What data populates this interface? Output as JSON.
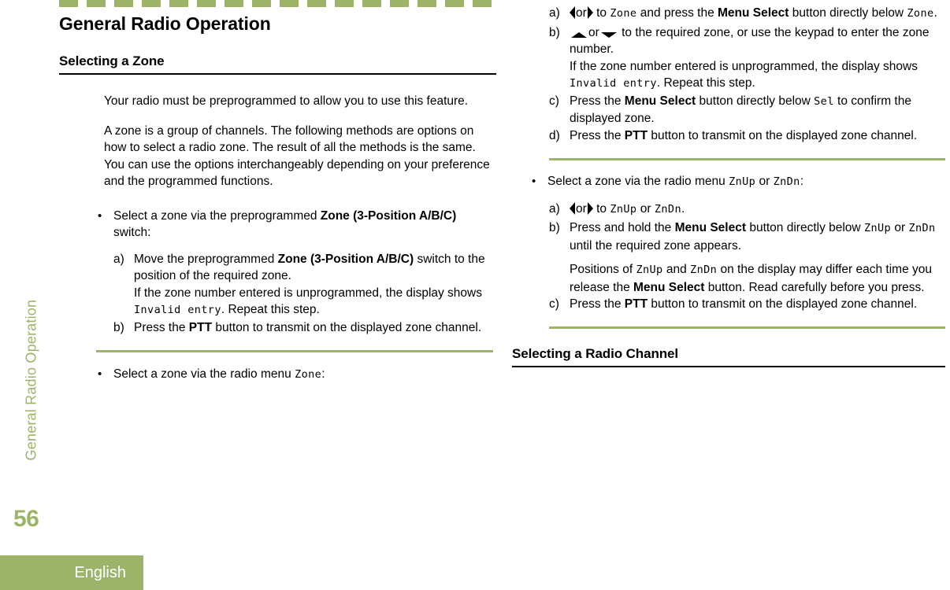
{
  "colors": {
    "accent_green": "#9cb46a",
    "text_black": "#000000",
    "white": "#ffffff"
  },
  "sidebar": {
    "chapter_tab": "General Radio Operation",
    "page_number": "56",
    "language": "English"
  },
  "left_column": {
    "chapter_title": "General Radio Operation",
    "section_heading": "Selecting a Zone",
    "paragraph_1": "Your radio must be preprogrammed to allow you to use this feature.",
    "paragraph_2": "A zone is a group of channels. The following methods are options on how to select a radio zone. The result of all the methods is the same. You can use the options interchangeably depending on your preference and the programmed functions.",
    "bullet_1": {
      "marker": "•",
      "text_part_1": "Select a zone via the preprogrammed ",
      "bold_part": "Zone (3-Position A/B/C)",
      "text_part_2": " switch:",
      "steps": [
        {
          "marker": "a)",
          "lines": [
            {
              "text_part_1": "Move the preprogrammed ",
              "bold_part": "Zone (3-Position A/B/C)",
              "text_part_2": " switch to the position of the required zone."
            },
            {
              "text_part_1": "If the zone number entered is unprogrammed, the display shows ",
              "lcd": "Invalid entry",
              "text_part_2": ". Repeat this step."
            }
          ]
        },
        {
          "marker": "b)",
          "lines": [
            {
              "text_part_1": "Press the ",
              "bold_part": "PTT",
              "text_part_2": " button to transmit on the displayed zone channel."
            }
          ]
        }
      ]
    },
    "bullet_2": {
      "marker": "•",
      "text_part_1": "Select a zone via the radio menu ",
      "lcd": "Zone",
      "text_part_2": ":"
    }
  },
  "right_column": {
    "steps_continued": [
      {
        "marker": "a)",
        "icon_left": "arrow-left-icon",
        "icon_right": "arrow-right-icon",
        "or_text": "or",
        "text_part_1": " to ",
        "lcd_1": "Zone",
        "text_part_2": " and press the ",
        "bold_part": "Menu Select",
        "text_part_3": " button directly below ",
        "lcd_2": "Zone",
        "text_part_4": "."
      },
      {
        "marker": "b)",
        "icon_up": "arrow-up-icon",
        "icon_down": "arrow-down-icon",
        "or_text": "or",
        "text_part_1": " to the required zone, or use the keypad to enter the zone number.",
        "sub_line": {
          "text_part_1": "If the zone number entered is unprogrammed, the display shows ",
          "lcd": "Invalid entry",
          "text_part_2": ". Repeat this step."
        }
      },
      {
        "marker": "c)",
        "text_part_1": "Press the ",
        "bold_part": "Menu Select",
        "text_part_2": " button directly below ",
        "lcd": "Sel",
        "text_part_3": " to confirm the displayed zone."
      },
      {
        "marker": "d)",
        "text_part_1": "Press the ",
        "bold_part": "PTT",
        "text_part_2": " button to transmit on the displayed zone channel."
      }
    ],
    "bullet_3": {
      "marker": "•",
      "text_part_1": "Select a zone via the radio menu ",
      "lcd_1": "ZnUp",
      "text_part_2": " or ",
      "lcd_2": "ZnDn",
      "text_part_3": ":",
      "steps": [
        {
          "marker": "a)",
          "icon_left": "arrow-left-icon",
          "icon_right": "arrow-right-icon",
          "or_text": "or",
          "text_part_1": " to ",
          "lcd_1": "ZnUp",
          "text_part_2": " or ",
          "lcd_2": "ZnDn",
          "text_part_3": "."
        },
        {
          "marker": "b)",
          "text_part_1": "Press and hold the ",
          "bold_part": "Menu Select",
          "text_part_2": " button directly below ",
          "lcd_1": "ZnUp",
          "text_part_3": " or ",
          "lcd_2": "ZnDn",
          "text_part_4": " until the required zone appears.",
          "sub_line": {
            "text_part_1": "Positions of ",
            "lcd_1": "ZnUp",
            "text_part_2": " and ",
            "lcd_2": "ZnDn",
            "text_part_3": " on the display may differ each time you release the ",
            "bold_part": "Menu Select",
            "text_part_4": " button. Read carefully before you press."
          }
        },
        {
          "marker": "c)",
          "text_part_1": "Press the ",
          "bold_part": "PTT",
          "text_part_2": " button to transmit on the displayed zone channel."
        }
      ]
    },
    "section_heading_2": "Selecting a Radio Channel"
  }
}
